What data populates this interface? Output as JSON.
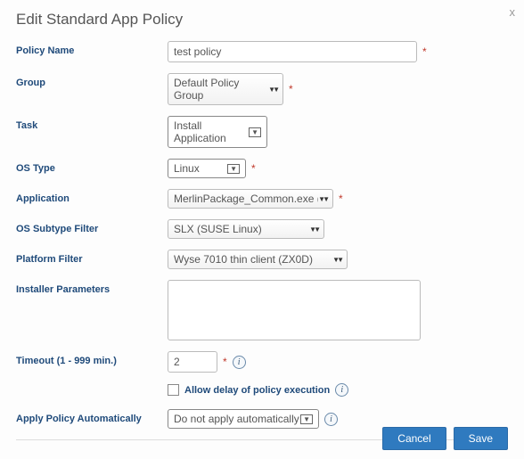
{
  "dialog": {
    "title": "Edit Standard App Policy",
    "close": "x"
  },
  "labels": {
    "policyName": "Policy Name",
    "group": "Group",
    "task": "Task",
    "osType": "OS Type",
    "application": "Application",
    "osSubtype": "OS Subtype Filter",
    "platform": "Platform Filter",
    "installer": "Installer Parameters",
    "timeout": "Timeout (1 - 999 min.)",
    "allowDelay": "Allow delay of policy execution",
    "applyPolicy": "Apply Policy Automatically"
  },
  "values": {
    "policyName": "test policy",
    "group": "Default Policy Group",
    "task": "Install Application",
    "osType": "Linux",
    "application": "MerlinPackage_Common.exe (Loc",
    "osSubtype": "SLX (SUSE Linux)",
    "platform": "Wyse 7010 thin client (ZX0D)",
    "installer": "",
    "timeout": "2",
    "applyPolicy": "Do not apply automatically"
  },
  "buttons": {
    "cancel": "Cancel",
    "save": "Save"
  },
  "asterisk": "*",
  "info": "i"
}
